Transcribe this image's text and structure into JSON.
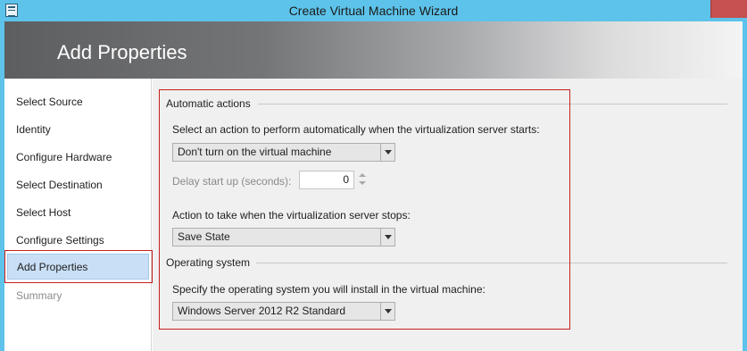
{
  "window": {
    "title": "Create Virtual Machine Wizard"
  },
  "header": {
    "title": "Add Properties"
  },
  "nav": {
    "items": [
      {
        "label": "Select Source"
      },
      {
        "label": "Identity"
      },
      {
        "label": "Configure Hardware"
      },
      {
        "label": "Select Destination"
      },
      {
        "label": "Select Host"
      },
      {
        "label": "Configure Settings"
      },
      {
        "label": "Add Properties",
        "selected": true
      },
      {
        "label": "Summary",
        "disabled": true
      }
    ]
  },
  "automatic_actions": {
    "section_title": "Automatic actions",
    "start_prompt": "Select an action to perform automatically when the virtualization server starts:",
    "start_action": "Don't turn on the virtual machine",
    "delay_label": "Delay start up (seconds):",
    "delay_value": "0",
    "stop_prompt": "Action to take when the virtualization server stops:",
    "stop_action": "Save State"
  },
  "operating_system": {
    "section_title": "Operating system",
    "prompt": "Specify the operating system you will install in the virtual machine:",
    "value": "Windows Server 2012 R2 Standard"
  },
  "colors": {
    "titlebar": "#5dc3ea",
    "close_button": "#c75050",
    "highlight_box": "#c81e1e",
    "selected_nav": "#c9dff5"
  },
  "icons": {
    "app": "window-app-icon",
    "dropdown": "chevron-down-icon",
    "spin_up": "spin-up-icon",
    "spin_down": "spin-down-icon"
  }
}
